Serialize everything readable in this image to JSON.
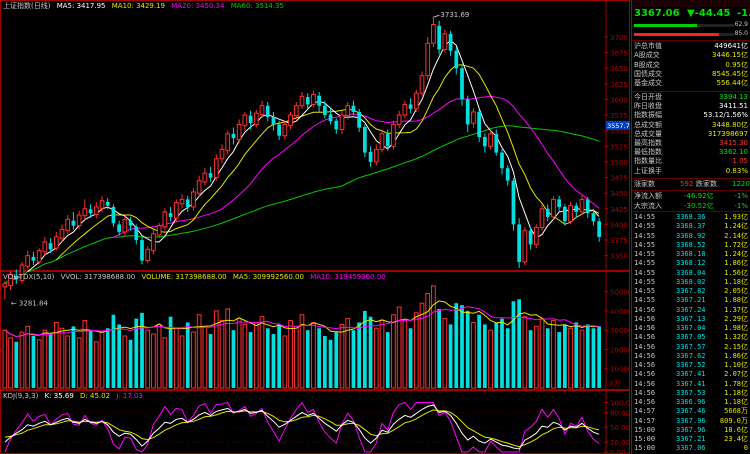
{
  "header": {
    "index_name": "上证指数(日线)",
    "ma": [
      {
        "label": "MA5: 3417.95",
        "color": "#ffffff"
      },
      {
        "label": "MA10: 3429.19",
        "color": "#e6e600"
      },
      {
        "label": "MA20: 3450.34",
        "color": "#ff00ff"
      },
      {
        "label": "MA60: 3514.35",
        "color": "#00cc00"
      }
    ]
  },
  "vol_header": [
    {
      "label": "VOL-TDX(5,10)",
      "color": "#c8c8c8"
    },
    {
      "label": "VVOL: 317398688.00",
      "color": "#c8c8c8"
    },
    {
      "label": "VOLUME: 317398688.00",
      "color": "#e6e600"
    },
    {
      "label": "MA5: 309992560.00",
      "color": "#e6e600"
    },
    {
      "label": "MA10: 319459360.00",
      "color": "#ff00ff"
    }
  ],
  "kdj_header": [
    {
      "label": "KDJ(9,3,3)",
      "color": "#c8c8c8"
    },
    {
      "label": "K: 35.69",
      "color": "#ffffff"
    },
    {
      "label": "D: 45.02",
      "color": "#e6e600"
    },
    {
      "label": "J: 17.03",
      "color": "#ff00ff"
    }
  ],
  "annotations": {
    "high": "3731.69",
    "low": "3281.84",
    "current_axis": "3557.7",
    "vol_unit": "X万"
  },
  "price_axis": [
    "3700",
    "3675",
    "3650",
    "3625",
    "3600",
    "3575",
    "3550",
    "3525",
    "3500",
    "3475",
    "3450",
    "3425",
    "3400",
    "3375",
    "3350"
  ],
  "vol_axis": [
    "50000",
    "40000",
    "30000",
    "20000",
    "10000"
  ],
  "kdj_axis": [
    "100.00",
    "80.00",
    "50.00",
    "20.00",
    "0.00"
  ],
  "candles": [
    [
      3300,
      3305,
      3280,
      3310
    ],
    [
      3302,
      3320,
      3295,
      3325
    ],
    [
      3318,
      3312,
      3305,
      3328
    ],
    [
      3310,
      3335,
      3306,
      3340
    ],
    [
      3333,
      3350,
      3328,
      3358
    ],
    [
      3348,
      3342,
      3335,
      3356
    ],
    [
      3340,
      3358,
      3336,
      3362
    ],
    [
      3356,
      3372,
      3350,
      3380
    ],
    [
      3370,
      3360,
      3354,
      3378
    ],
    [
      3362,
      3380,
      3358,
      3388
    ],
    [
      3378,
      3392,
      3372,
      3400
    ],
    [
      3390,
      3408,
      3385,
      3415
    ],
    [
      3406,
      3398,
      3392,
      3420
    ],
    [
      3398,
      3415,
      3392,
      3422
    ],
    [
      3414,
      3425,
      3408,
      3440
    ],
    [
      3424,
      3418,
      3410,
      3432
    ],
    [
      3416,
      3428,
      3410,
      3436
    ],
    [
      3426,
      3438,
      3420,
      3445
    ],
    [
      3436,
      3430,
      3424,
      3442
    ],
    [
      3428,
      3402,
      3396,
      3432
    ],
    [
      3400,
      3388,
      3382,
      3406
    ],
    [
      3388,
      3408,
      3380,
      3414
    ],
    [
      3406,
      3398,
      3390,
      3412
    ],
    [
      3396,
      3375,
      3368,
      3400
    ],
    [
      3375,
      3342,
      3336,
      3380
    ],
    [
      3342,
      3360,
      3338,
      3365
    ],
    [
      3358,
      3385,
      3352,
      3392
    ],
    [
      3383,
      3398,
      3378,
      3402
    ],
    [
      3396,
      3420,
      3390,
      3426
    ],
    [
      3418,
      3412,
      3405,
      3428
    ],
    [
      3410,
      3435,
      3405,
      3440
    ],
    [
      3433,
      3440,
      3426,
      3448
    ],
    [
      3440,
      3428,
      3420,
      3446
    ],
    [
      3428,
      3452,
      3422,
      3458
    ],
    [
      3450,
      3470,
      3445,
      3478
    ],
    [
      3468,
      3482,
      3462,
      3490
    ],
    [
      3482,
      3475,
      3468,
      3492
    ],
    [
      3475,
      3505,
      3470,
      3512
    ],
    [
      3505,
      3520,
      3498,
      3528
    ],
    [
      3518,
      3545,
      3512,
      3550
    ],
    [
      3545,
      3538,
      3528,
      3555
    ],
    [
      3536,
      3560,
      3530,
      3568
    ],
    [
      3558,
      3575,
      3550,
      3580
    ],
    [
      3574,
      3562,
      3552,
      3582
    ],
    [
      3560,
      3578,
      3555,
      3584
    ],
    [
      3576,
      3590,
      3570,
      3598
    ],
    [
      3590,
      3572,
      3565,
      3596
    ],
    [
      3572,
      3560,
      3550,
      3580
    ],
    [
      3560,
      3542,
      3535,
      3566
    ],
    [
      3542,
      3560,
      3536,
      3566
    ],
    [
      3558,
      3575,
      3552,
      3580
    ],
    [
      3574,
      3590,
      3568,
      3596
    ],
    [
      3590,
      3605,
      3585,
      3612
    ],
    [
      3604,
      3592,
      3585,
      3610
    ],
    [
      3592,
      3608,
      3588,
      3614
    ],
    [
      3606,
      3590,
      3580,
      3612
    ],
    [
      3590,
      3575,
      3570,
      3598
    ],
    [
      3576,
      3565,
      3560,
      3585
    ],
    [
      3566,
      3552,
      3545,
      3570
    ],
    [
      3552,
      3575,
      3545,
      3582
    ],
    [
      3574,
      3590,
      3568,
      3596
    ],
    [
      3590,
      3580,
      3575,
      3598
    ],
    [
      3580,
      3555,
      3548,
      3585
    ],
    [
      3556,
      3515,
      3508,
      3560
    ],
    [
      3516,
      3500,
      3492,
      3525
    ],
    [
      3500,
      3520,
      3494,
      3528
    ],
    [
      3520,
      3545,
      3515,
      3552
    ],
    [
      3545,
      3525,
      3518,
      3552
    ],
    [
      3525,
      3560,
      3520,
      3566
    ],
    [
      3560,
      3575,
      3554,
      3582
    ],
    [
      3575,
      3592,
      3570,
      3598
    ],
    [
      3592,
      3585,
      3578,
      3602
    ],
    [
      3585,
      3610,
      3580,
      3616
    ],
    [
      3610,
      3638,
      3605,
      3645
    ],
    [
      3638,
      3690,
      3632,
      3700
    ],
    [
      3690,
      3720,
      3684,
      3731.69
    ],
    [
      3718,
      3680,
      3672,
      3726
    ],
    [
      3680,
      3705,
      3675,
      3712
    ],
    [
      3705,
      3678,
      3670,
      3710
    ],
    [
      3678,
      3650,
      3640,
      3684
    ],
    [
      3650,
      3600,
      3590,
      3656
    ],
    [
      3600,
      3560,
      3548,
      3606
    ],
    [
      3562,
      3580,
      3555,
      3586
    ],
    [
      3580,
      3540,
      3532,
      3584
    ],
    [
      3540,
      3525,
      3515,
      3546
    ],
    [
      3525,
      3545,
      3520,
      3550
    ],
    [
      3545,
      3515,
      3510,
      3552
    ],
    [
      3515,
      3490,
      3480,
      3520
    ],
    [
      3490,
      3470,
      3462,
      3495
    ],
    [
      3470,
      3400,
      3390,
      3474
    ],
    [
      3400,
      3340,
      3330,
      3410
    ],
    [
      3340,
      3390,
      3335,
      3396
    ],
    [
      3390,
      3368,
      3360,
      3396
    ],
    [
      3368,
      3395,
      3362,
      3400
    ],
    [
      3395,
      3425,
      3390,
      3432
    ],
    [
      3425,
      3412,
      3405,
      3432
    ],
    [
      3412,
      3440,
      3408,
      3445
    ],
    [
      3440,
      3428,
      3420,
      3446
    ],
    [
      3428,
      3405,
      3398,
      3432
    ],
    [
      3405,
      3430,
      3400,
      3436
    ],
    [
      3430,
      3420,
      3412,
      3435
    ],
    [
      3420,
      3440,
      3415,
      3446
    ],
    [
      3440,
      3418,
      3410,
      3444
    ],
    [
      3418,
      3405,
      3398,
      3425
    ],
    [
      3405,
      3380,
      3372,
      3410
    ]
  ],
  "volumes": [
    30,
    26,
    24,
    29,
    32,
    27,
    25,
    30,
    28,
    34,
    31,
    27,
    32,
    26,
    35,
    30,
    24,
    29,
    31,
    38,
    33,
    27,
    25,
    36,
    39,
    30,
    28,
    33,
    26,
    37,
    31,
    27,
    34,
    29,
    38,
    32,
    28,
    40,
    35,
    41,
    30,
    36,
    33,
    29,
    34,
    37,
    31,
    28,
    33,
    27,
    35,
    32,
    38,
    30,
    34,
    31,
    27,
    25,
    29,
    33,
    36,
    30,
    34,
    40,
    37,
    31,
    35,
    29,
    38,
    42,
    35,
    31,
    39,
    44,
    49,
    53,
    41,
    36,
    33,
    44,
    43,
    40,
    34,
    38,
    33,
    30,
    34,
    36,
    31,
    45,
    46,
    37,
    30,
    32,
    36,
    31,
    35,
    29,
    33,
    31,
    34,
    30,
    33,
    31,
    32
  ],
  "kdj": {
    "k": [
      20,
      30,
      38,
      45,
      55,
      52,
      58,
      62,
      55,
      60,
      65,
      68,
      60,
      58,
      66,
      60,
      58,
      62,
      55,
      40,
      32,
      38,
      36,
      25,
      12,
      22,
      38,
      48,
      60,
      58,
      66,
      68,
      60,
      66,
      75,
      80,
      74,
      82,
      85,
      88,
      80,
      82,
      86,
      78,
      80,
      84,
      72,
      62,
      50,
      56,
      64,
      72,
      80,
      74,
      78,
      68,
      58,
      50,
      42,
      55,
      64,
      60,
      46,
      28,
      18,
      28,
      44,
      40,
      56,
      66,
      74,
      70,
      78,
      86,
      92,
      95,
      80,
      82,
      74,
      58,
      38,
      24,
      32,
      22,
      18,
      26,
      20,
      14,
      12,
      8,
      6,
      24,
      30,
      38,
      52,
      50,
      60,
      56,
      44,
      52,
      50,
      58,
      48,
      40,
      35.69
    ],
    "d": [
      30,
      32,
      35,
      38,
      44,
      47,
      51,
      55,
      55,
      57,
      60,
      63,
      62,
      60,
      62,
      61,
      60,
      61,
      59,
      52,
      45,
      42,
      40,
      35,
      27,
      25,
      29,
      36,
      44,
      49,
      55,
      59,
      60,
      62,
      66,
      71,
      72,
      75,
      79,
      82,
      81,
      81,
      83,
      81,
      81,
      82,
      78,
      72,
      64,
      61,
      62,
      65,
      70,
      71,
      74,
      72,
      67,
      61,
      54,
      54,
      57,
      58,
      54,
      45,
      36,
      33,
      37,
      38,
      44,
      51,
      59,
      62,
      67,
      74,
      80,
      85,
      83,
      83,
      80,
      72,
      61,
      49,
      43,
      36,
      30,
      28,
      25,
      21,
      18,
      14,
      11,
      15,
      20,
      26,
      35,
      40,
      47,
      50,
      48,
      49,
      49,
      52,
      51,
      47,
      45.02
    ],
    "j": [
      0,
      26,
      44,
      59,
      77,
      62,
      72,
      76,
      55,
      66,
      75,
      78,
      56,
      54,
      74,
      58,
      54,
      64,
      47,
      16,
      6,
      30,
      28,
      5,
      0,
      16,
      56,
      72,
      92,
      76,
      88,
      86,
      60,
      74,
      93,
      98,
      78,
      96,
      97,
      100,
      78,
      84,
      92,
      72,
      78,
      88,
      60,
      42,
      22,
      46,
      68,
      86,
      100,
      80,
      86,
      60,
      40,
      28,
      18,
      57,
      78,
      64,
      30,
      0,
      0,
      18,
      58,
      44,
      80,
      96,
      100,
      86,
      100,
      100,
      100,
      100,
      74,
      80,
      62,
      30,
      0,
      0,
      10,
      0,
      0,
      22,
      10,
      0,
      0,
      0,
      0,
      42,
      50,
      62,
      86,
      70,
      86,
      68,
      36,
      58,
      52,
      70,
      42,
      26,
      17.03
    ],
    "ma5": [
      3300,
      3305,
      3310,
      3320,
      3330,
      3340,
      3350,
      3360,
      3365,
      3370,
      3380,
      3390,
      3398,
      3405,
      3412,
      3418,
      3422,
      3426,
      3428,
      3420
    ],
    "note": ""
  },
  "quote": {
    "price": "3367.06",
    "change": "▼-44.45",
    "pct": "-1.30%",
    "bar1_val": "62.9",
    "bar2_val": "85.0",
    "bar1_pct": 0.629,
    "bar2_pct": 0.85
  },
  "info_rows": [
    {
      "label": "沪总市值",
      "value": "449641亿",
      "color": "#ffffff"
    },
    {
      "label": "A股成交",
      "value": "3446.15亿",
      "color": "#e6e600"
    },
    {
      "label": "B股成交",
      "value": "0.95亿",
      "color": "#e6e600"
    },
    {
      "label": "国债成交",
      "value": "8545.45亿",
      "color": "#e6e600"
    },
    {
      "label": "基金成交",
      "value": "556.44亿",
      "color": "#e6e600"
    }
  ],
  "stat_rows": [
    {
      "label": "今日开盘",
      "value": "3394.13",
      "color": "#00e000"
    },
    {
      "label": "昨日收盘",
      "value": "3411.51",
      "color": "#ffffff"
    },
    {
      "label": "指数振幅",
      "value": "53.12/1.56%",
      "color": "#ffffff"
    },
    {
      "label": "总成交额",
      "value": "3448.80亿",
      "color": "#e6e600"
    },
    {
      "label": "总成交量",
      "value": "317398697",
      "color": "#e6e600"
    },
    {
      "label": "最高指数",
      "value": "3415.30",
      "color": "#ff3030"
    },
    {
      "label": "最低指数",
      "value": "3362.10",
      "color": "#00e000"
    },
    {
      "label": "指数量比",
      "value": "1.05",
      "color": "#ff3030"
    },
    {
      "label": "上证换手",
      "value": "0.83%",
      "color": "#e6e600"
    }
  ],
  "updown": {
    "up_label": "涨家数",
    "up_value": "592",
    "down_label": "跌家数",
    "down_value": "1220"
  },
  "flow_rows": [
    {
      "label": "净流入额",
      "value": "-46.92亿",
      "pct": "-1%"
    },
    {
      "label": "大宗流入",
      "value": "-30.52亿",
      "pct": "-1%"
    }
  ],
  "ticks": [
    {
      "time": "14:55",
      "price": "3368.36",
      "vol": "1.93亿"
    },
    {
      "time": "14:55",
      "price": "3368.37",
      "vol": "1.24亿"
    },
    {
      "time": "14:55",
      "price": "3368.92",
      "vol": "2.14亿"
    },
    {
      "time": "14:55",
      "price": "3368.52",
      "vol": "1.72亿"
    },
    {
      "time": "14:55",
      "price": "3368.18",
      "vol": "1.24亿"
    },
    {
      "time": "14:55",
      "price": "3368.12",
      "vol": "1.86亿"
    },
    {
      "time": "14:55",
      "price": "3368.04",
      "vol": "1.56亿"
    },
    {
      "time": "14:55",
      "price": "3368.02",
      "vol": "1.18亿"
    },
    {
      "time": "14:55",
      "price": "3367.82",
      "vol": "2.05亿"
    },
    {
      "time": "14:55",
      "price": "3367.21",
      "vol": "1.88亿"
    },
    {
      "time": "14:56",
      "price": "3367.24",
      "vol": "1.37亿"
    },
    {
      "time": "14:56",
      "price": "3367.13",
      "vol": "2.29亿"
    },
    {
      "time": "14:56",
      "price": "3367.04",
      "vol": "1.98亿"
    },
    {
      "time": "14:56",
      "price": "3367.05",
      "vol": "1.32亿"
    },
    {
      "time": "14:56",
      "price": "3367.57",
      "vol": "2.15亿"
    },
    {
      "time": "14:56",
      "price": "3367.62",
      "vol": "1.86亿"
    },
    {
      "time": "14:56",
      "price": "3367.52",
      "vol": "1.10亿"
    },
    {
      "time": "14:56",
      "price": "3367.41",
      "vol": "2.07亿"
    },
    {
      "time": "14:56",
      "price": "3367.41",
      "vol": "1.78亿"
    },
    {
      "time": "14:56",
      "price": "3367.53",
      "vol": "1.18亿"
    },
    {
      "time": "14:56",
      "price": "3366.96",
      "vol": "1.18亿"
    },
    {
      "time": "14:57",
      "price": "3367.46",
      "vol": "5668万"
    },
    {
      "time": "14:57",
      "price": "3367.96",
      "vol": "809.0万"
    },
    {
      "time": "15:00",
      "price": "3367.96",
      "vol": "18.6亿"
    },
    {
      "time": "15:00",
      "price": "3367.21",
      "vol": "23.4亿"
    },
    {
      "time": "15:00",
      "price": "3367.06",
      "vol": "0"
    }
  ],
  "colors": {
    "up": "#ff3030",
    "down": "#00e0e0",
    "axis": "#a00000",
    "ma5": "#ffffff",
    "ma10": "#e6e600",
    "ma20": "#ff00ff",
    "ma60": "#00cc00"
  }
}
